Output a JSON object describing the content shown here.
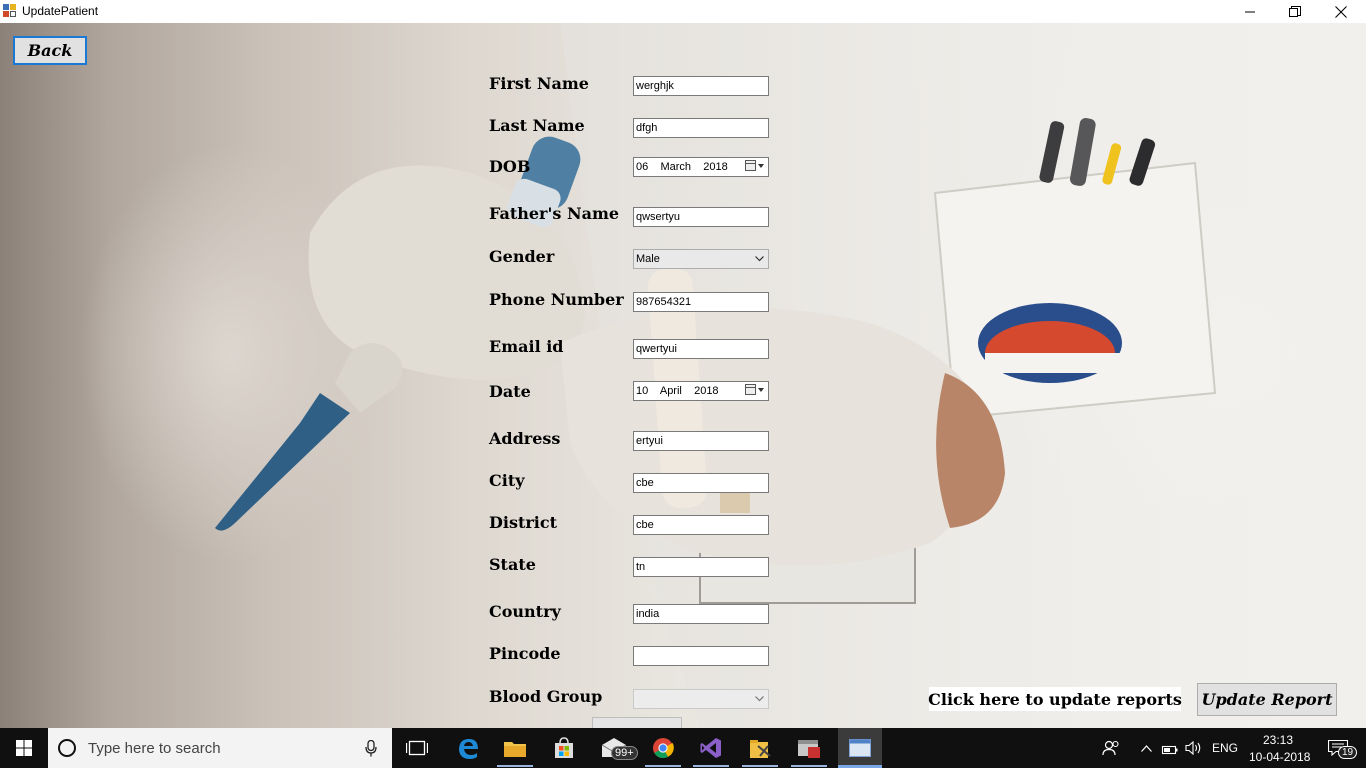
{
  "window": {
    "title": "UpdatePatient",
    "minimize_icon": "minimize-icon",
    "maximize_icon": "restore-icon",
    "close_icon": "close-icon"
  },
  "back_button": "Back",
  "form": {
    "fields": [
      {
        "label": "First Name",
        "type": "text",
        "value": "werghjk"
      },
      {
        "label": "Last Name",
        "type": "text",
        "value": "dfgh"
      },
      {
        "label": "DOB",
        "type": "date",
        "value": "06    March    2018"
      },
      {
        "label": "Father's Name",
        "type": "text",
        "value": "qwsertyu"
      },
      {
        "label": "Gender",
        "type": "select",
        "value": "Male"
      },
      {
        "label": "Phone Number",
        "type": "text",
        "value": "987654321"
      },
      {
        "label": "Email id",
        "type": "text",
        "value": "qwertyui"
      },
      {
        "label": "Date",
        "type": "date",
        "value": "10    April    2018"
      },
      {
        "label": "Address",
        "type": "text",
        "value": "ertyui"
      },
      {
        "label": "City",
        "type": "text",
        "value": "cbe"
      },
      {
        "label": "District",
        "type": "text",
        "value": "cbe"
      },
      {
        "label": "State",
        "type": "text",
        "value": "tn"
      },
      {
        "label": "Country",
        "type": "text",
        "value": "india"
      },
      {
        "label": "Pincode",
        "type": "text",
        "value": ""
      },
      {
        "label": "Blood Group",
        "type": "select-disabled",
        "value": ""
      }
    ]
  },
  "update_reports_label": "Click here to update reports",
  "update_report_button": "Update Report",
  "taskbar": {
    "search_placeholder": "Type here to search",
    "mail_badge": "99+",
    "language": "ENG",
    "time": "23:13",
    "date": "10-04-2018",
    "notification_count": "19"
  },
  "colors": {
    "focus_border": "#1979d4",
    "taskbar": "#101010",
    "search_box": "#f3f3f3"
  }
}
